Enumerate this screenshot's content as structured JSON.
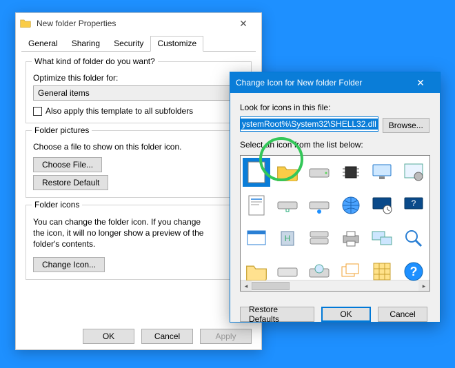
{
  "props": {
    "title": "New folder Properties",
    "tabs": [
      "General",
      "Sharing",
      "Security",
      "Customize"
    ],
    "active_tab": 3,
    "group1": {
      "legend": "What kind of folder do you want?",
      "optimize_label": "Optimize this folder for:",
      "combo_value": "General items",
      "checkbox_label": "Also apply this template to all subfolders"
    },
    "group2": {
      "legend": "Folder pictures",
      "desc": "Choose a file to show on this folder icon.",
      "choose_btn": "Choose File...",
      "restore_btn": "Restore Default"
    },
    "group3": {
      "legend": "Folder icons",
      "desc": "You can change the folder icon. If you change the icon, it will no longer show a preview of the folder's contents.",
      "change_btn": "Change Icon..."
    },
    "footer": {
      "ok": "OK",
      "cancel": "Cancel",
      "apply": "Apply"
    }
  },
  "ci": {
    "title": "Change Icon for New folder Folder",
    "look_label": "Look for icons in this file:",
    "path_value": "ystemRoot%\\System32\\SHELL32.dll",
    "browse_btn": "Browse...",
    "select_label": "Select an icon from the list below:",
    "icons": [
      {
        "name": "blank-file-icon",
        "selected": true
      },
      {
        "name": "folder-icon"
      },
      {
        "name": "drive-icon"
      },
      {
        "name": "chip-icon"
      },
      {
        "name": "monitor-people-icon"
      },
      {
        "name": "gear-window-icon"
      },
      {
        "name": "document-icon"
      },
      {
        "name": "network-drive-icon"
      },
      {
        "name": "network-drive2-icon"
      },
      {
        "name": "globe-icon"
      },
      {
        "name": "clock-monitor-icon"
      },
      {
        "name": "screen-help-icon"
      },
      {
        "name": "window-icon"
      },
      {
        "name": "server-h-icon"
      },
      {
        "name": "drive-stack-icon"
      },
      {
        "name": "printer-icon"
      },
      {
        "name": "display-settings-icon"
      },
      {
        "name": "search-icon"
      },
      {
        "name": "folder-open-icon"
      },
      {
        "name": "drive2-icon"
      },
      {
        "name": "disc-drive-icon"
      },
      {
        "name": "window-cascade-icon"
      },
      {
        "name": "grid-icon"
      },
      {
        "name": "help-icon"
      }
    ],
    "footer": {
      "restore": "Restore Defaults",
      "ok": "OK",
      "cancel": "Cancel"
    }
  }
}
